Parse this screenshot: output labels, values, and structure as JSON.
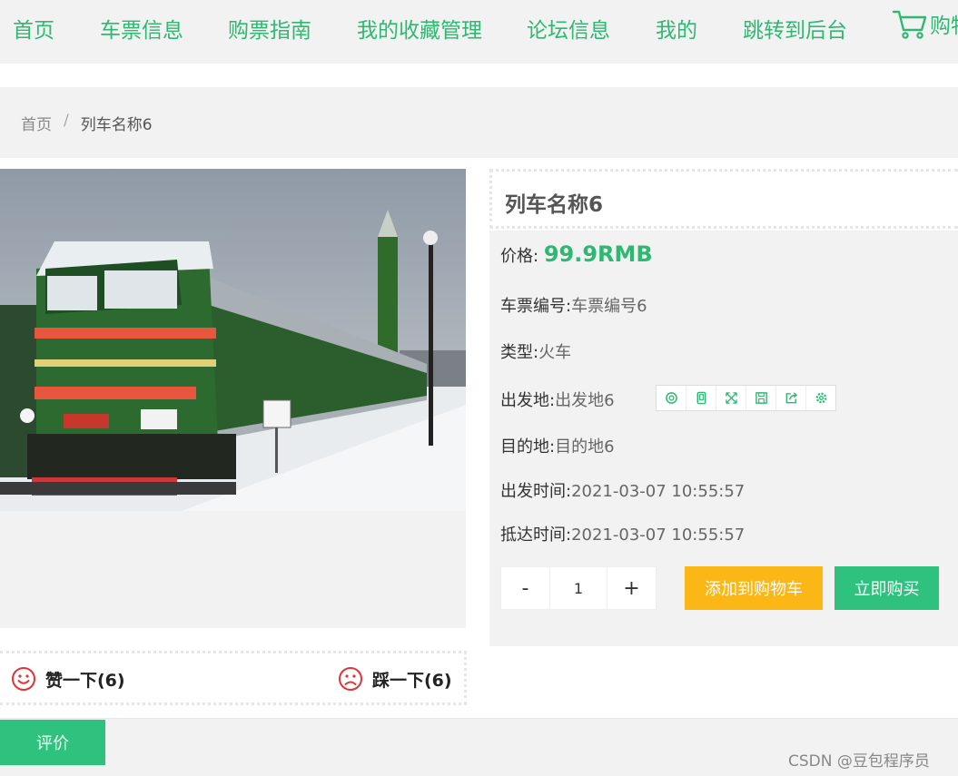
{
  "nav": {
    "items": [
      "首页",
      "车票信息",
      "购票指南",
      "我的收藏管理",
      "论坛信息",
      "我的",
      "跳转到后台"
    ],
    "cart_label": "购物车"
  },
  "breadcrumb": {
    "home": "首页",
    "separator": "/",
    "current": "列车名称6"
  },
  "product": {
    "title": "列车名称6",
    "price_label": "价格:",
    "price_value": "99.9RMB",
    "ticket_no_label": "车票编号:",
    "ticket_no": "车票编号6",
    "type_label": "类型:",
    "type": "火车",
    "origin_label": "出发地:",
    "origin": "出发地6",
    "destination_label": "目的地:",
    "destination": "目的地6",
    "depart_label": "出发时间:",
    "depart_time": "2021-03-07 10:55:57",
    "arrive_label": "抵达时间:",
    "arrive_time": "2021-03-07 10:55:57"
  },
  "quantity": {
    "minus": "-",
    "value": "1",
    "plus": "+"
  },
  "actions": {
    "add_to_cart": "添加到购物车",
    "buy_now": "立即购买"
  },
  "votes": {
    "like": "赞一下(6)",
    "dislike": "踩一下(6)"
  },
  "tabs": {
    "active": "评价"
  },
  "watermark": "CSDN @豆包程序员",
  "toolbar_icons": [
    "copy-icon",
    "mobile-icon",
    "fullscreen-icon",
    "save-icon",
    "share-icon",
    "settings-icon"
  ],
  "colors": {
    "accent": "#2eb872",
    "cart_button": "#fbb716",
    "buy_button": "#2ec27e",
    "vote_icon": "#e0333a"
  }
}
